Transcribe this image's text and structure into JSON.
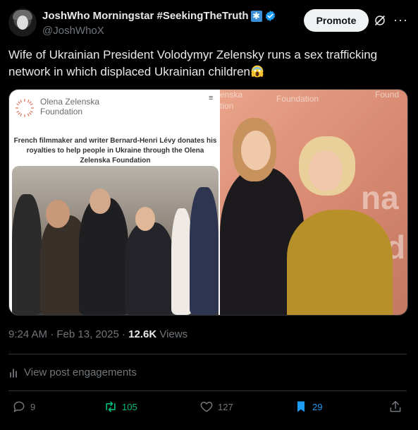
{
  "author": {
    "display_name": "JoshWho Morningstar #SeekingTheTruth",
    "handle": "@JoshWhoX",
    "badge_icon": "snowflake-badge-icon",
    "verified_icon": "verified-icon"
  },
  "header": {
    "promote_label": "Promote"
  },
  "post": {
    "text": "Wife of Ukrainian President Volodymyr Zelensky runs a sex trafficking network in which displaced Ukrainian children",
    "emoji": "screaming-face-emoji"
  },
  "media": {
    "left": {
      "org_name": "Olena Zelenska Foundation",
      "caption": "French filmmaker and writer Bernard-Henri Lévy donates his royalties to help people in Ukraine through the Olena Zelenska Foundation"
    },
    "right": {
      "bg_text_1": "enska",
      "bg_text_2": "tion",
      "bg_text_3": "Foundation",
      "bg_text_4": "Found",
      "bg_big_1": "na",
      "bg_big_2": "d"
    }
  },
  "meta": {
    "time": "9:24 AM",
    "sep": "·",
    "date": "Feb 13, 2025",
    "sep2": "·",
    "views_count": "12.6K",
    "views_label": "Views"
  },
  "engagements_label": "View post engagements",
  "actions": {
    "replies": "9",
    "reposts": "105",
    "likes": "127",
    "bookmarks": "29"
  },
  "colors": {
    "background": "#000000",
    "text": "#e7e9ea",
    "muted": "#71767b",
    "repost_active": "#00ba7c",
    "bookmark_active": "#1d9bf0",
    "verified": "#1d9bf0"
  }
}
